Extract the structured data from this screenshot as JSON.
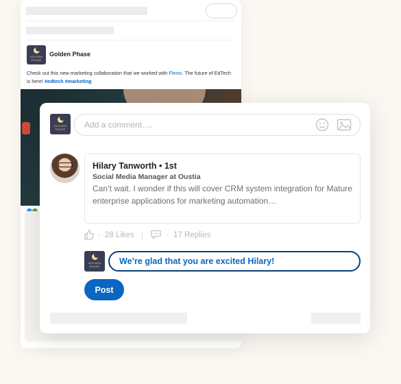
{
  "post": {
    "company_name": "Golden Phase",
    "logo_text_top": "GOLDEN",
    "logo_text_bottom": "PHASE",
    "text_before": "Check out this new marketing collaboration that we worked with ",
    "link": "Flexis",
    "text_after": ". The future of EdTech is here! ",
    "hashtags": "#edtech #marketing"
  },
  "comment_box": {
    "placeholder": "Add a comment….",
    "emoji_icon": "smiley-icon",
    "image_icon": "image-icon"
  },
  "comment": {
    "author": "Hilary Tanworth • 1st",
    "role": "Social  Media Manager at Oustia",
    "text": "Can’t wait. I wonder if this will cover CRM system integration for Mature enterprise applications for marketing automation…",
    "likes": "28 Likes",
    "replies": "17 Replies",
    "like_icon": "thumbs-up-icon",
    "reply_icon": "speech-bubble-icon"
  },
  "reply": {
    "value": "We’re glad that you are excited Hilary!",
    "post_label": "Post"
  },
  "colors": {
    "accent": "#0a66c2",
    "logo_bg": "#3a3d54",
    "page_bg": "#fbf8f3"
  }
}
